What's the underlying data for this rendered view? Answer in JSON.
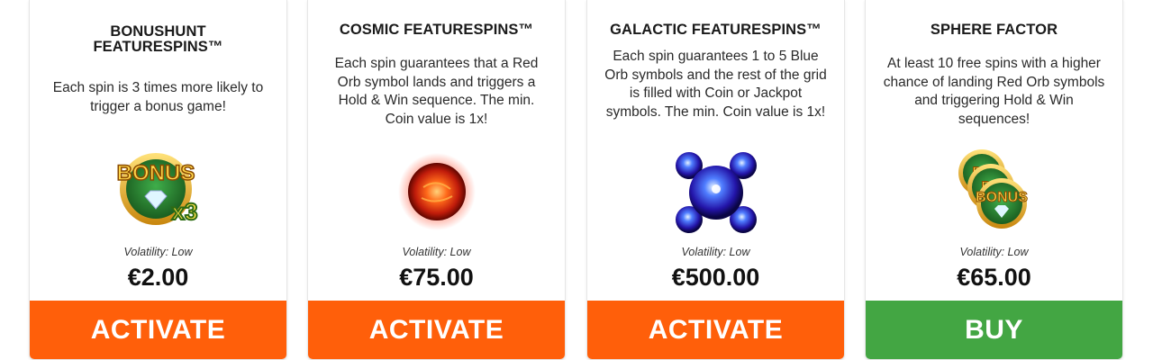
{
  "colors": {
    "activate": "#ff5f0a",
    "buy": "#43a643"
  },
  "cards": [
    {
      "title": "BONUSHUNT FEATURESPINS™",
      "description": "Each spin is 3 times more likely to trigger a bonus game!",
      "icon": "bonus-x3-coin-icon",
      "volatility": "Volatility: Low",
      "price": "€2.00",
      "button": "ACTIVATE"
    },
    {
      "title": "COSMIC FEATURESPINS™",
      "description": "Each spin guarantees that a Red Orb symbol lands and triggers a Hold & Win sequence. The min. Coin value is 1x!",
      "icon": "red-orb-icon",
      "volatility": "Volatility: Low",
      "price": "€75.00",
      "button": "ACTIVATE"
    },
    {
      "title": "GALACTIC FEATURESPINS™",
      "description": "Each spin guarantees 1 to 5 Blue Orb symbols and the rest of the grid is filled with Coin or Jackpot symbols. The min. Coin value is 1x!",
      "icon": "blue-orbs-icon",
      "volatility": "Volatility: Low",
      "price": "€500.00",
      "button": "ACTIVATE"
    },
    {
      "title": "SPHERE FACTOR",
      "description": "At least 10 free spins with a higher chance of landing Red Orb symbols and triggering Hold & Win sequences!",
      "icon": "stacked-bonus-coins-icon",
      "volatility": "Volatility: Low",
      "price": "€65.00",
      "button": "BUY"
    }
  ]
}
